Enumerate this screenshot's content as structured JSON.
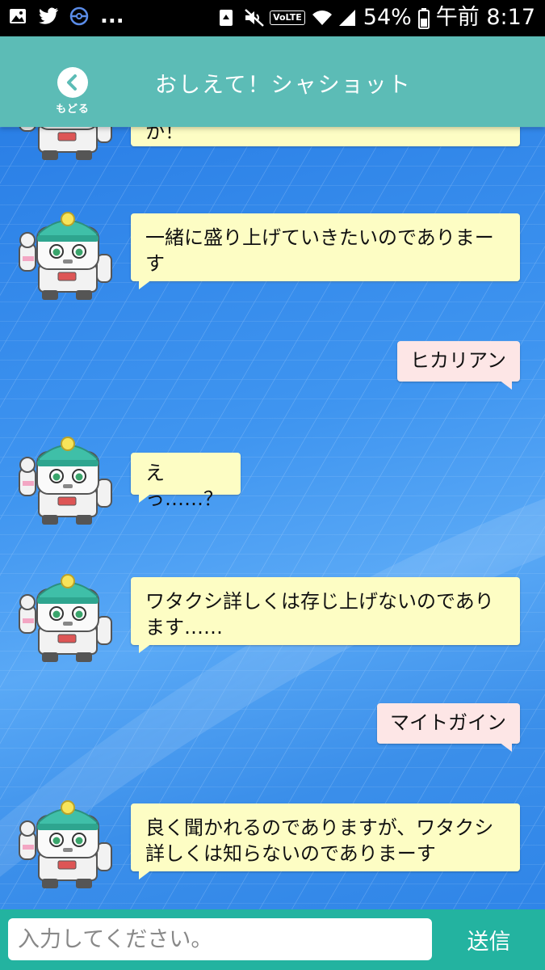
{
  "status_bar": {
    "battery": "54%",
    "time": "午前 8:17",
    "ellipsis": "...",
    "network_badge": "VoLTE"
  },
  "header": {
    "back_label": "もどる",
    "title": "おしえて！シャショット"
  },
  "messages": [
    {
      "sender": "bot",
      "text": "か！"
    },
    {
      "sender": "bot",
      "text": "一緒に盛り上げていきたいのでありまーす"
    },
    {
      "sender": "user",
      "text": "ヒカリアン"
    },
    {
      "sender": "bot",
      "text": "えっ……？"
    },
    {
      "sender": "bot",
      "text": "ワタクシ詳しくは存じ上げないのであります……"
    },
    {
      "sender": "user",
      "text": "マイトガイン"
    },
    {
      "sender": "bot",
      "text": "良く聞かれるのでありますが、ワタクシ詳しくは知らないのでありまーす"
    }
  ],
  "input": {
    "placeholder": "入力してください。",
    "send_label": "送信"
  },
  "colors": {
    "header_bg": "#5cbcb6",
    "input_bar_bg": "#23b3a0",
    "bot_bubble": "#fdfdc4",
    "user_bubble": "#fde6e6",
    "chat_bg": "#3b8fea"
  },
  "icons": [
    "image-icon",
    "twitter-icon",
    "pokeball-icon",
    "recycle-icon",
    "mute-icon",
    "wifi-icon",
    "signal-icon",
    "battery-icon",
    "back-arrow-icon",
    "robot-avatar-icon"
  ]
}
